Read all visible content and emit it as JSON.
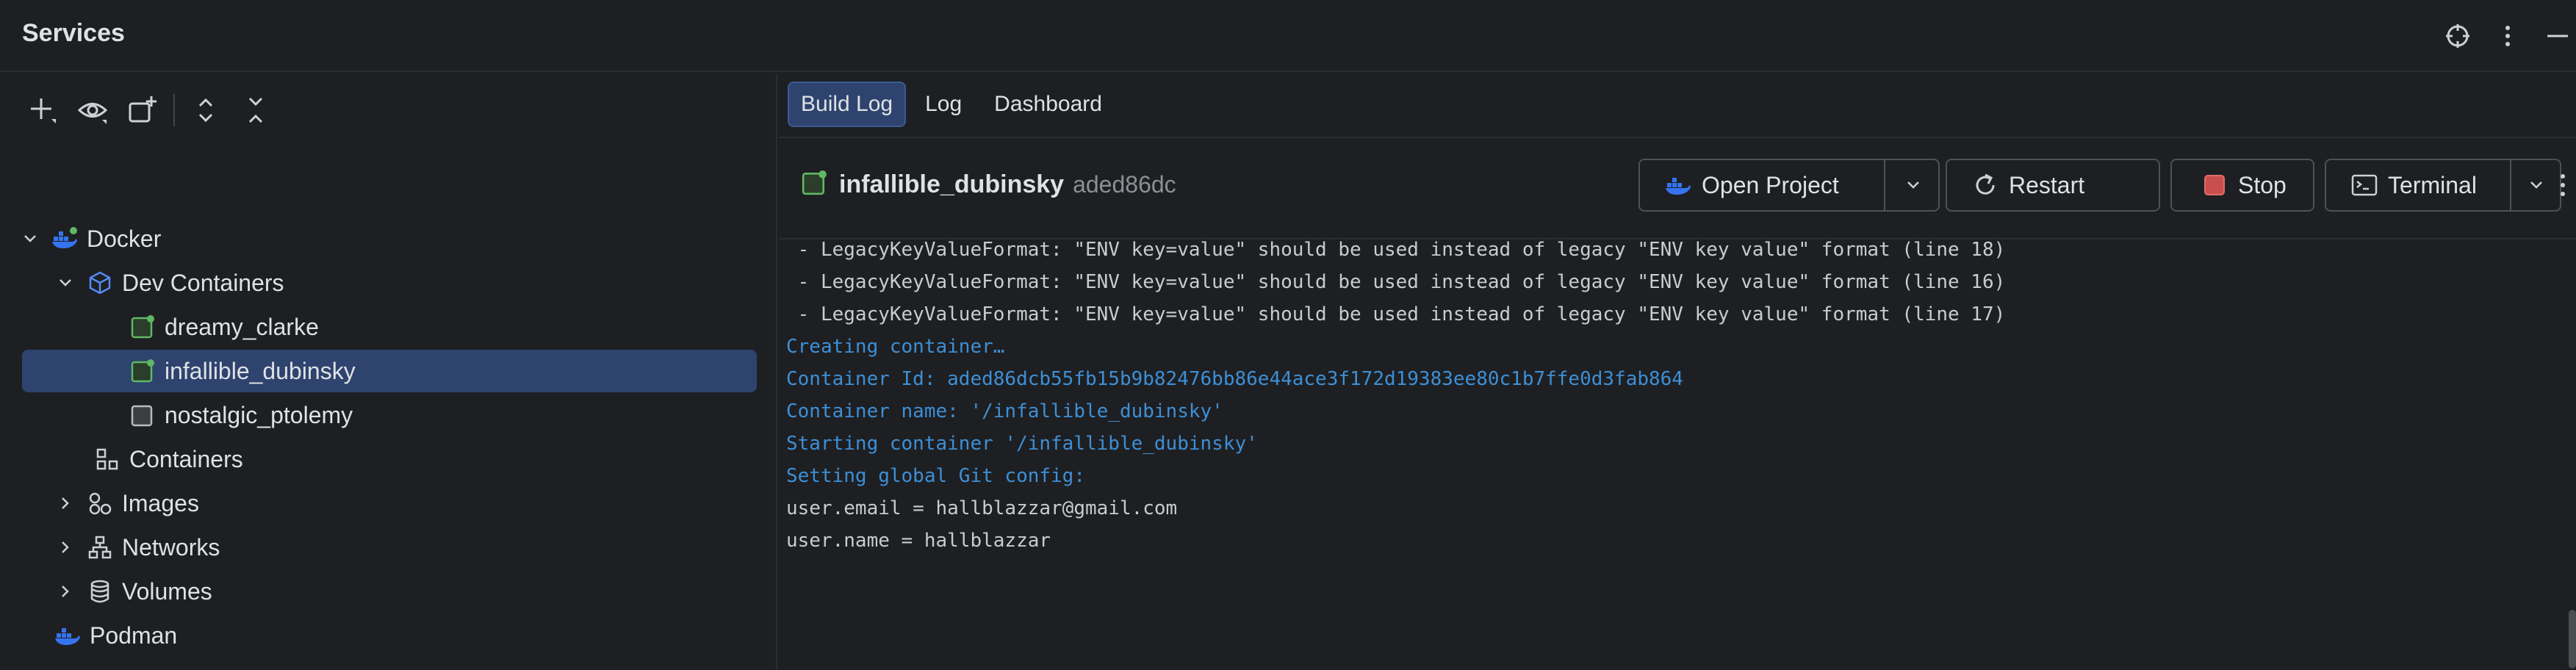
{
  "window": {
    "title": "Services"
  },
  "toolbar": {
    "add_icon": "plus-icon",
    "view_icon": "eye-icon",
    "new_group_icon": "new-group-icon",
    "expand_icon": "expand-all-icon",
    "collapse_icon": "collapse-all-icon"
  },
  "tree": {
    "docker": "Docker",
    "dev_containers": "Dev Containers",
    "c1": "dreamy_clarke",
    "c2": "infallible_dubinsky",
    "c3": "nostalgic_ptolemy",
    "containers": "Containers",
    "images": "Images",
    "networks": "Networks",
    "volumes": "Volumes",
    "podman": "Podman"
  },
  "tabs": [
    "Build Log",
    "Log",
    "Dashboard"
  ],
  "active_tab": "Build Log",
  "container": {
    "name": "infallible_dubinsky",
    "id": "aded86dc",
    "status": "running"
  },
  "actions": {
    "open_project": "Open Project",
    "restart": "Restart",
    "stop": "Stop",
    "terminal": "Terminal"
  },
  "log": [
    {
      "text": " - LegacyKeyValueFormat: \"ENV key=value\" should be used instead of legacy \"ENV key value\" format (line 18)",
      "color": "white"
    },
    {
      "text": " - LegacyKeyValueFormat: \"ENV key=value\" should be used instead of legacy \"ENV key value\" format (line 16)",
      "color": "white"
    },
    {
      "text": " - LegacyKeyValueFormat: \"ENV key=value\" should be used instead of legacy \"ENV key value\" format (line 17)",
      "color": "white"
    },
    {
      "text": "Creating container…",
      "color": "blue"
    },
    {
      "text": "Container Id: aded86dcb55fb15b9b82476bb86e44ace3f172d19383ee80c1b7ffe0d3fab864",
      "color": "blue"
    },
    {
      "text": "Container name: '/infallible_dubinsky'",
      "color": "blue"
    },
    {
      "text": "Starting container '/infallible_dubinsky'",
      "color": "blue"
    },
    {
      "text": "Setting global Git config:",
      "color": "blue"
    },
    {
      "text": "user.email = hallblazzar@gmail.com",
      "color": "white"
    },
    {
      "text": "user.name = hallblazzar",
      "color": "white"
    }
  ],
  "colors": {
    "background": "#1e1f22",
    "selection": "#2e436e",
    "log_blue": "#3d8fd6",
    "running_green": "#5fb865",
    "docker_blue": "#3574f0"
  }
}
